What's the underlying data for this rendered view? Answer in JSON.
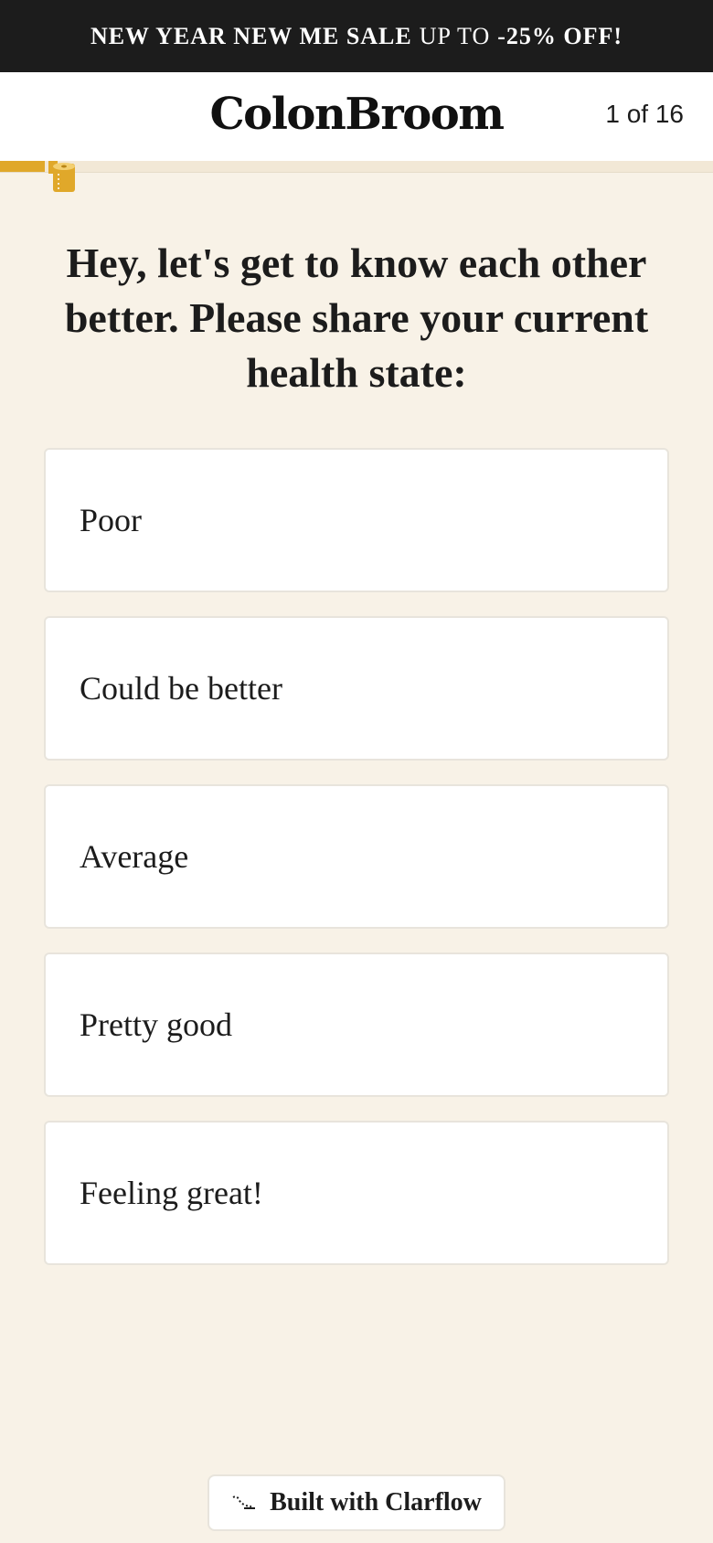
{
  "promo": {
    "part1": "NEW YEAR NEW ME SALE",
    "part2": "UP TO",
    "part3": "-25% OFF!"
  },
  "header": {
    "logo": "ColonBroom",
    "step": "1 of 16"
  },
  "progress": {
    "fraction": 0.0625,
    "thumb_icon": "toilet-paper-icon",
    "color": "#e0a82a"
  },
  "question": "Hey, let's get to know each other better. Please share your current health state:",
  "options": [
    "Poor",
    "Could be better",
    "Average",
    "Pretty good",
    "Feeling great!"
  ],
  "footer": {
    "built_with": "Built with Clarflow",
    "icon": "clarflow-icon"
  },
  "colors": {
    "promo_bg": "#1c1c1c",
    "page_bg": "#f8f2e7",
    "accent": "#e0a82a"
  }
}
